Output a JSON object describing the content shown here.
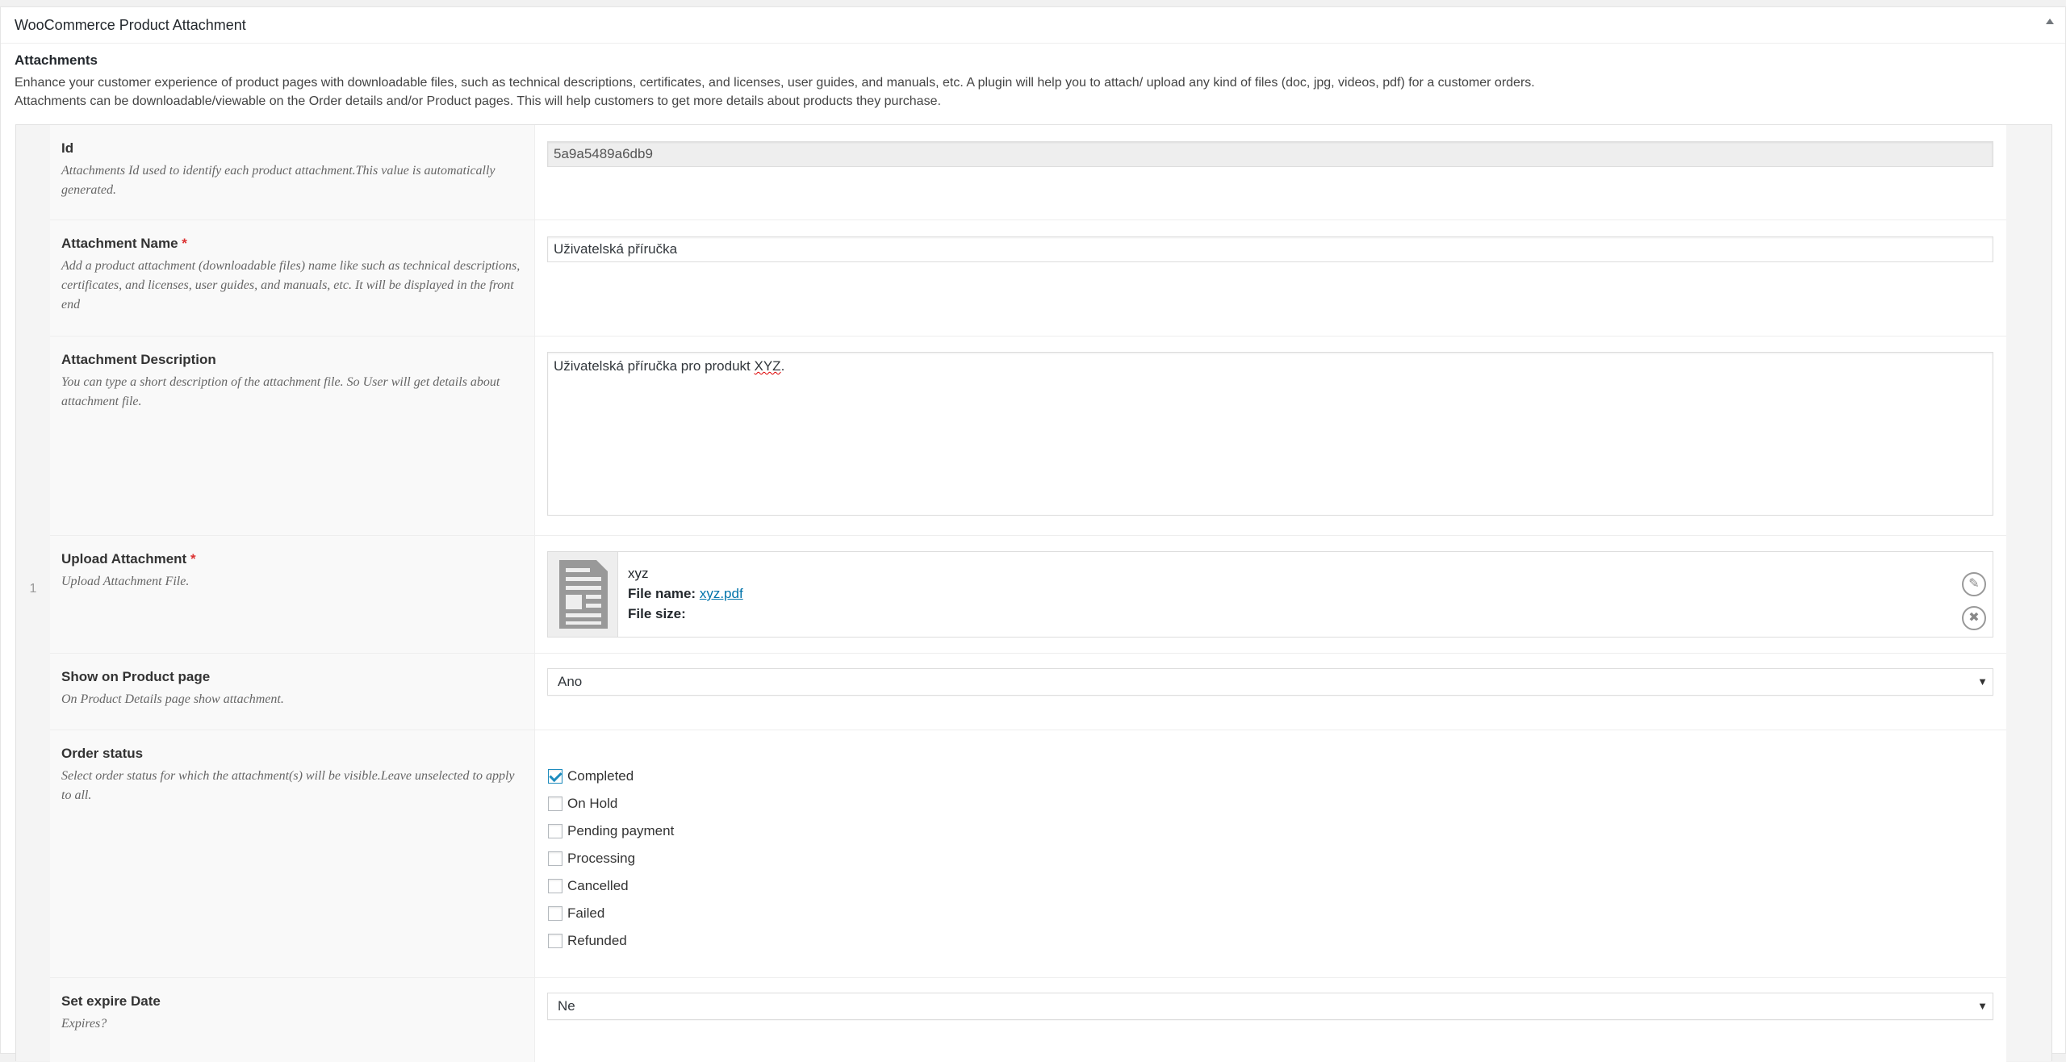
{
  "panel": {
    "title": "WooCommerce Product Attachment"
  },
  "intro": {
    "heading": "Attachments",
    "line1": "Enhance your customer experience of product pages with downloadable files, such as technical descriptions, certificates, and licenses, user guides, and manuals, etc. A plugin will help you to attach/ upload any kind of files (doc, jpg, videos, pdf) for a customer orders.",
    "line2": "Attachments can be downloadable/viewable on the Order details and/or Product pages. This will help customers to get more details about products they purchase."
  },
  "row_number": "1",
  "fields": {
    "id": {
      "label": "Id",
      "desc": "Attachments Id used to identify each product attachment.This value is automatically generated.",
      "value": "5a9a5489a6db9"
    },
    "name": {
      "label": "Attachment Name",
      "required": "*",
      "desc": "Add a product attachment (downloadable files) name like such as technical descriptions, certificates, and licenses, user guides, and manuals, etc. It will be displayed in the front end",
      "value": "Uživatelská příručka"
    },
    "description": {
      "label": "Attachment Description",
      "desc": "You can type a short description of the attachment file. So User will get details about attachment file.",
      "value_prefix": "Uživatelská příručka pro produkt ",
      "value_misspelled": "XYZ",
      "value_suffix": "."
    },
    "upload": {
      "label": "Upload Attachment",
      "required": "*",
      "desc": "Upload Attachment File.",
      "file_title": "xyz",
      "file_name_label": "File name:",
      "file_name": "xyz.pdf",
      "file_size_label": "File size:",
      "file_size": "",
      "edit_icon": "pencil-icon",
      "remove_icon": "close-icon"
    },
    "show_on_product": {
      "label": "Show on Product page",
      "desc": "On Product Details page show attachment.",
      "selected": "Ano"
    },
    "order_status": {
      "label": "Order status",
      "desc": "Select order status for which the attachment(s) will be visible.Leave unselected to apply to all.",
      "options": [
        {
          "label": "Completed",
          "checked": true
        },
        {
          "label": "On Hold",
          "checked": false
        },
        {
          "label": "Pending payment",
          "checked": false
        },
        {
          "label": "Processing",
          "checked": false
        },
        {
          "label": "Cancelled",
          "checked": false
        },
        {
          "label": "Failed",
          "checked": false
        },
        {
          "label": "Refunded",
          "checked": false
        }
      ]
    },
    "expire": {
      "label": "Set expire Date",
      "desc": "Expires?",
      "selected": "Ne"
    }
  },
  "colors": {
    "link": "#0073aa",
    "required": "#dc3232",
    "checkbox_accent": "#1e8cbe"
  }
}
